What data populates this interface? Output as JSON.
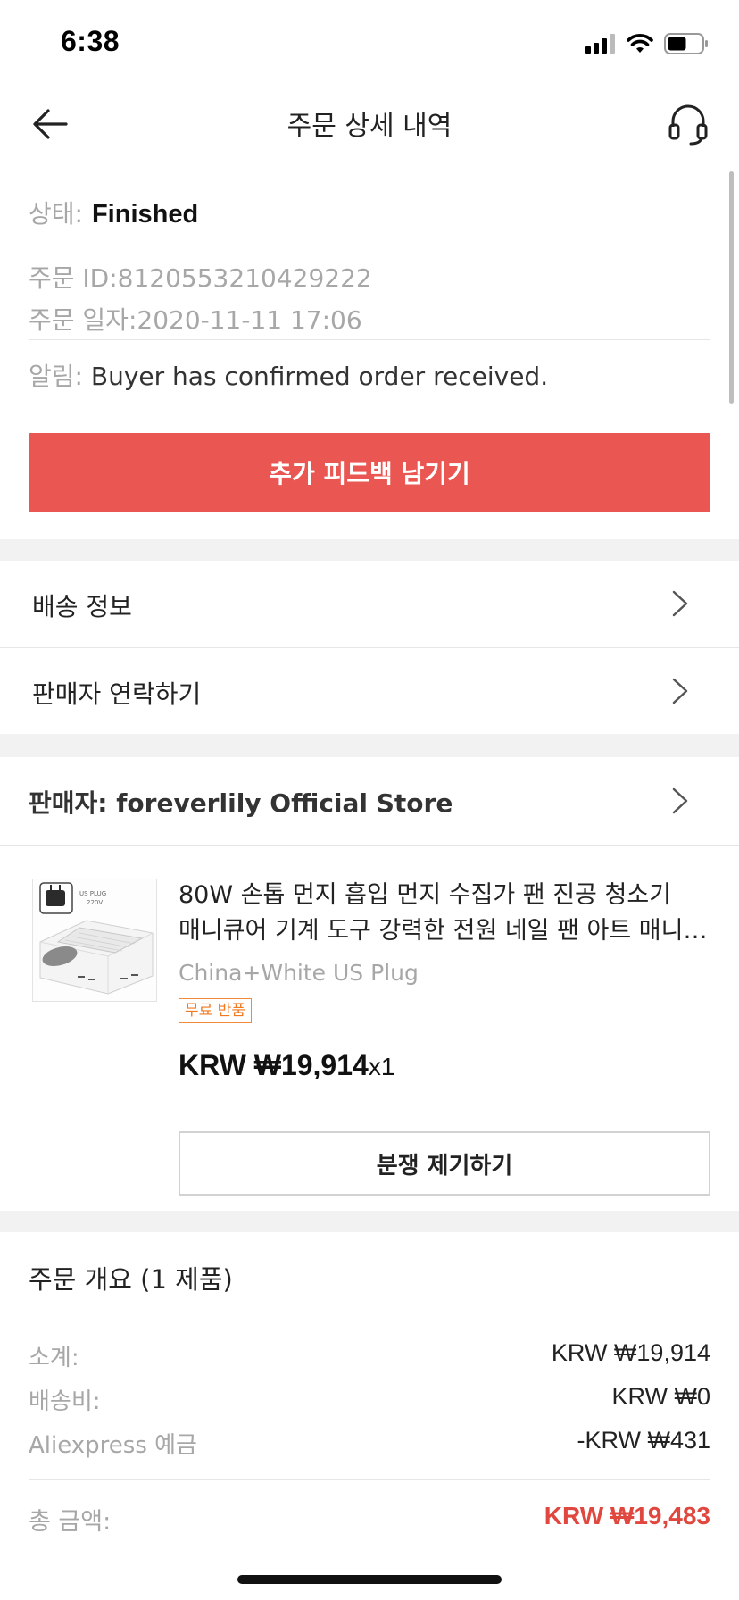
{
  "status_bar": {
    "time": "6:38"
  },
  "nav": {
    "title": "주문 상세 내역"
  },
  "order": {
    "status_label": "상태:",
    "status_value": "Finished",
    "order_id": "주문 ID:8120553210429222",
    "order_date": "주문 일자:2020-11-11 17:06",
    "notice_label": "알림:",
    "notice_text": "Buyer has confirmed order received.",
    "feedback_button": "추가 피드백 남기기"
  },
  "menu": {
    "shipping_info": "배송 정보",
    "contact_seller": "판매자 연락하기"
  },
  "seller": {
    "label": "판매자: foreverlily Official Store"
  },
  "product": {
    "title_line1": "80W 손톱 먼지 흡입 먼지 수집가 팬 진공 청소기",
    "title_line2": "매니큐어 기계 도구 강력한 전원 네일 팬 아트 매니큐어",
    "variant": "China+White US Plug",
    "badge": "무료 반품",
    "price": "KRW ₩19,914",
    "quantity": "x1",
    "image_text_1": "US PLUG",
    "image_text_2": "220V",
    "dispute_button": "분쟁 제기하기"
  },
  "summary": {
    "title": "주문 개요 (1 제품)",
    "rows": [
      {
        "label": "소계:",
        "value": "KRW ₩19,914"
      },
      {
        "label": "배송비:",
        "value": "KRW ₩0"
      },
      {
        "label": "Aliexpress 예금",
        "value": "-KRW ₩431"
      }
    ],
    "total_label": "총 금액:",
    "total_value": "KRW ₩19,483"
  },
  "colors": {
    "accent": "#ea5651",
    "total": "#e0473f",
    "badge": "#f07a20",
    "separator": "#f2f2f2"
  }
}
